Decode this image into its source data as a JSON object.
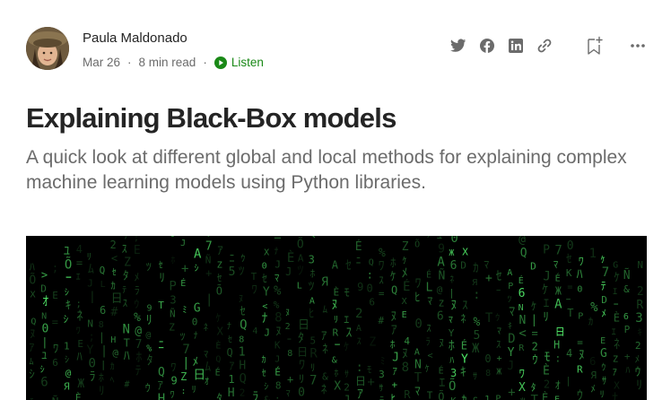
{
  "author": {
    "name": "Paula Maldonado",
    "date": "Mar 26",
    "separator": "·",
    "read_time": "8 min read",
    "listen_label": "Listen"
  },
  "article": {
    "title": "Explaining Black-Box models",
    "subtitle": "A quick look at different global and local methods for explaining complex machine learning models using Python libraries."
  },
  "actions": {
    "icons": [
      "twitter-icon",
      "facebook-icon",
      "linkedin-icon",
      "link-icon",
      "bookmark-add-icon",
      "more-icon"
    ]
  },
  "colors": {
    "text": "#242424",
    "muted": "#6b6b6b",
    "accent": "#1a8917",
    "icon": "#6b6b6b",
    "hero_glyph": "#3fd46b"
  },
  "hero": {
    "description_glyphs": "matrix-style green character rain"
  }
}
